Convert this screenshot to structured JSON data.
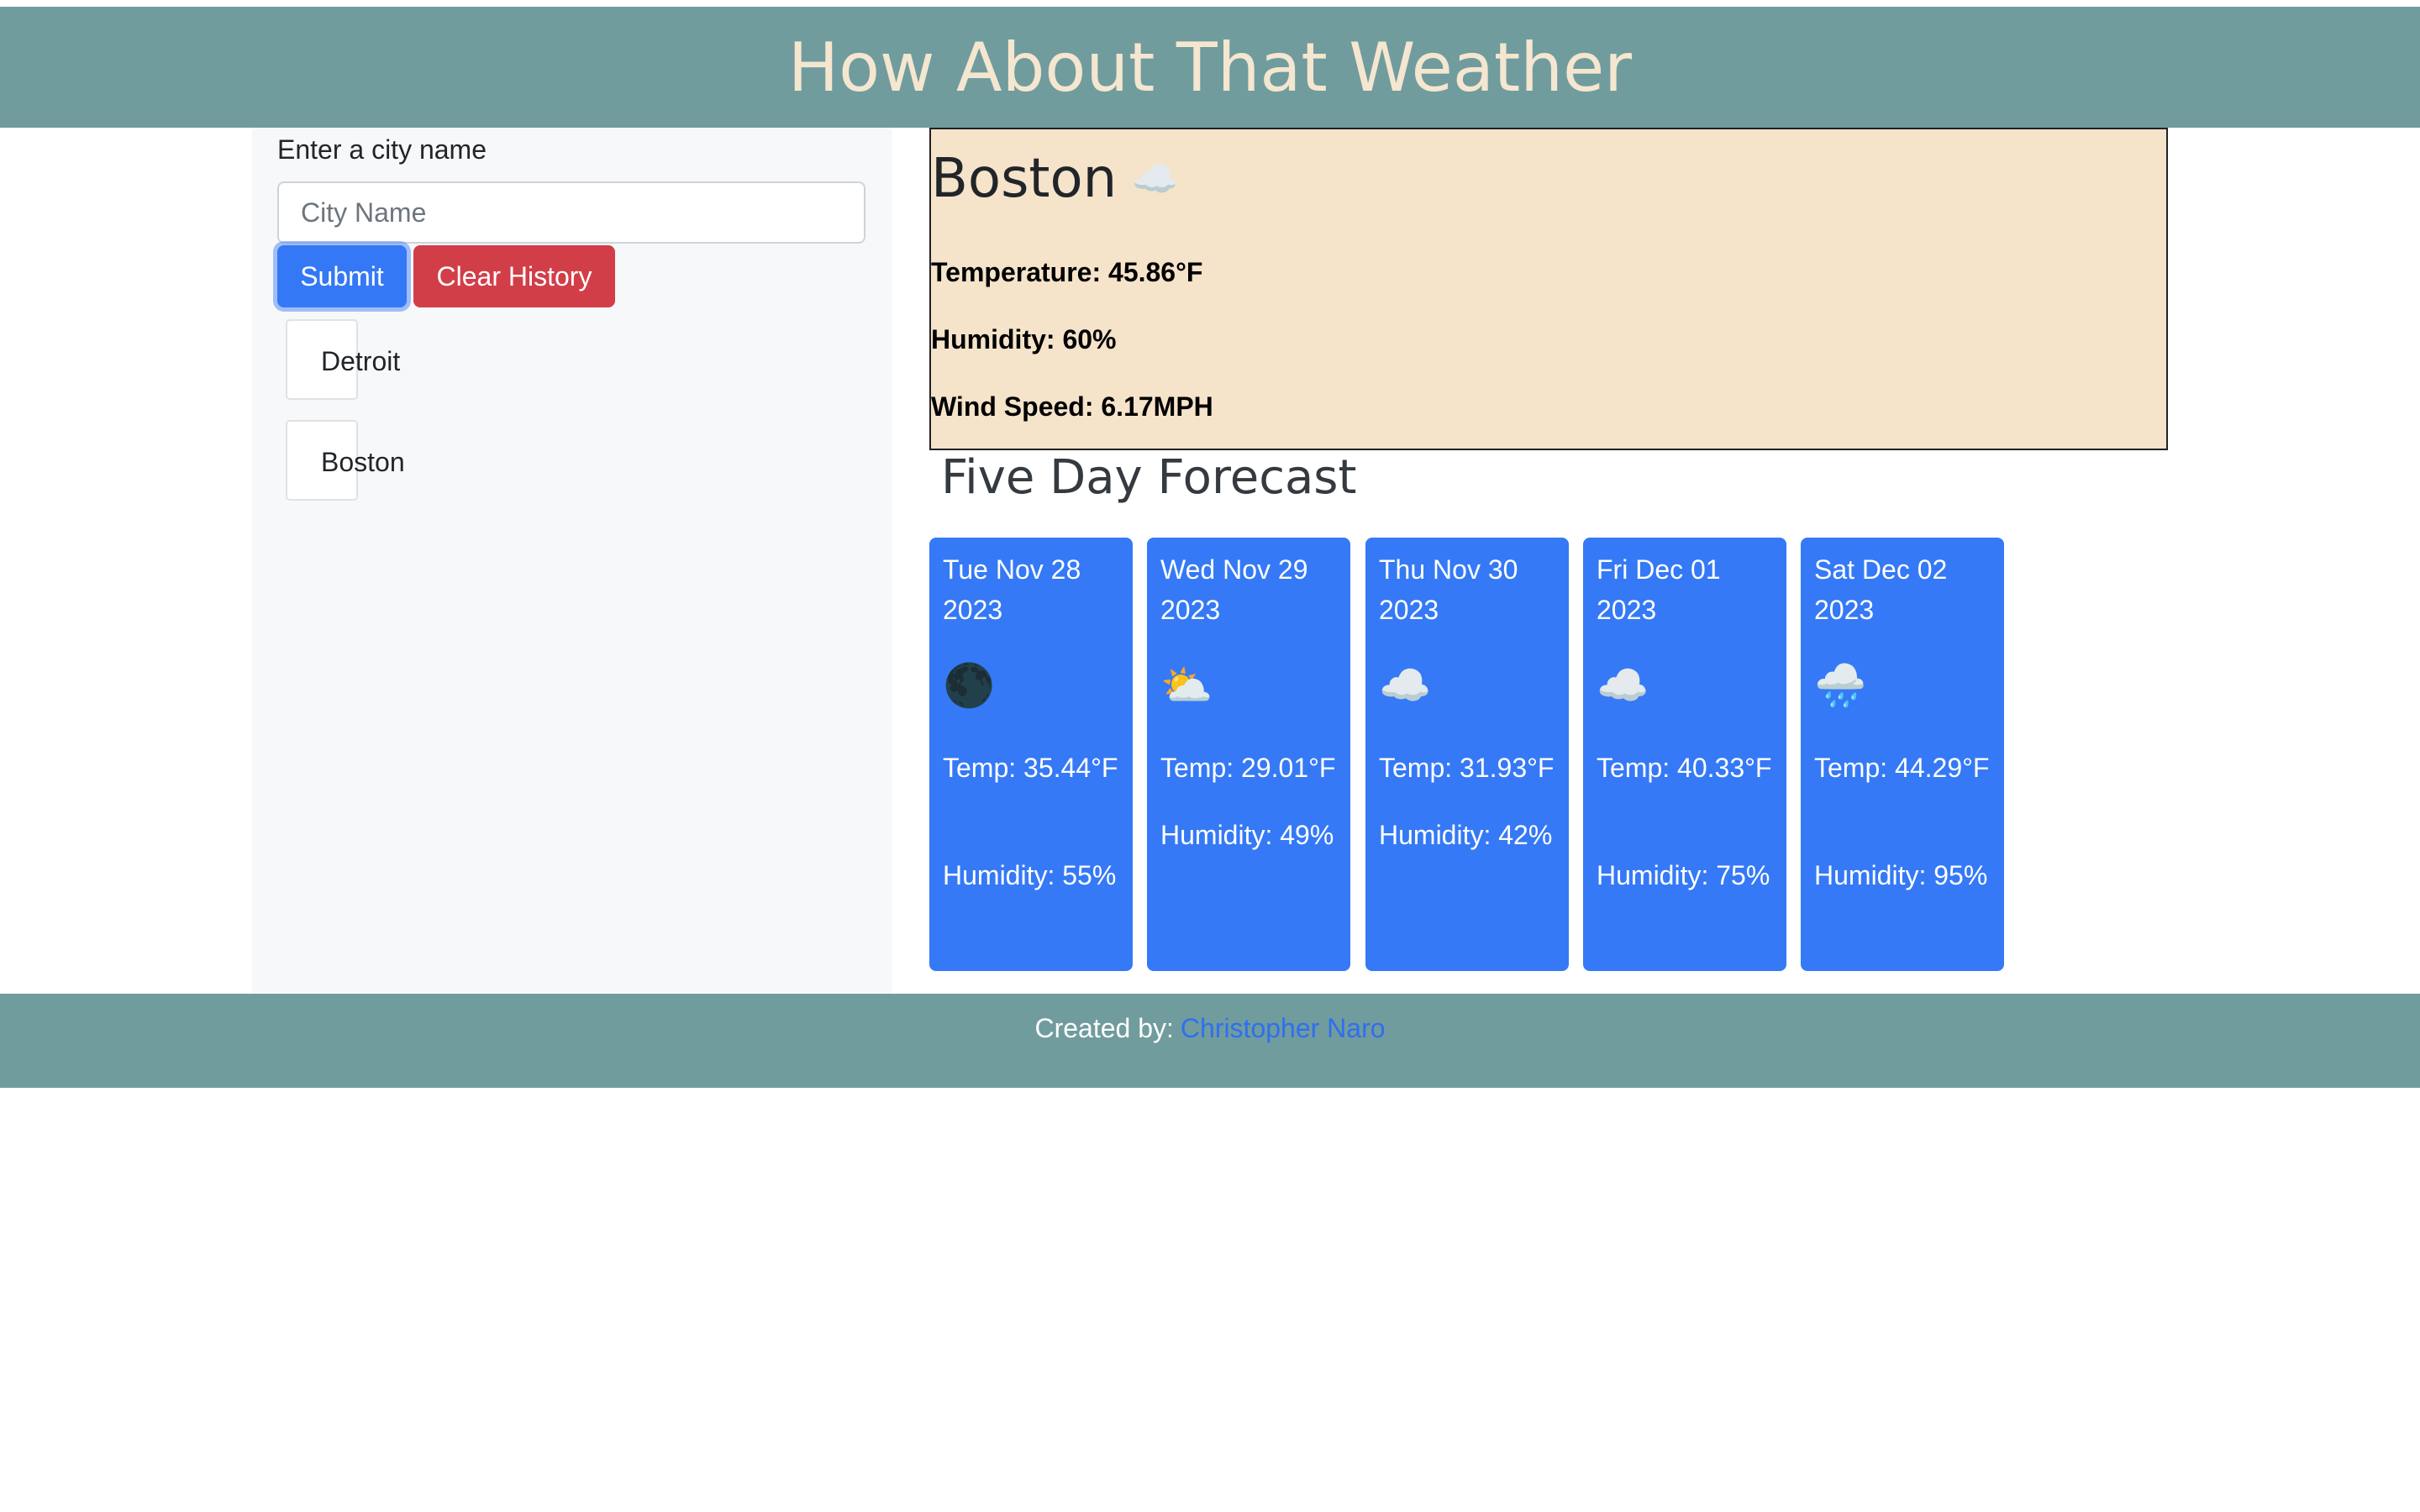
{
  "header": {
    "title": "How About That Weather"
  },
  "search": {
    "label": "Enter a city name",
    "placeholder": "City Name",
    "value": "",
    "submit_label": "Submit",
    "clear_label": "Clear History"
  },
  "history": [
    {
      "label": "Detroit"
    },
    {
      "label": "Boston"
    }
  ],
  "current": {
    "city": "Boston",
    "icon": "cloud-icon",
    "temperature": "Temperature: 45.86°F",
    "humidity": "Humidity: 60%",
    "wind": "Wind Speed: 6.17MPH"
  },
  "forecast": {
    "title": "Five Day Forecast",
    "days": [
      {
        "date": "Tue Nov 28 2023",
        "icon": "clear-night-icon",
        "temp": "Temp: 35.44°F",
        "humidity": "Humidity: 55%"
      },
      {
        "date": "Wed Nov 29 2023",
        "icon": "partly-cloudy-icon",
        "temp": "Temp: 29.01°F",
        "humidity": "Humidity: 49%"
      },
      {
        "date": "Thu Nov 30 2023",
        "icon": "broken-clouds-icon",
        "temp": "Temp: 31.93°F",
        "humidity": "Humidity: 42%"
      },
      {
        "date": "Fri Dec 01 2023",
        "icon": "broken-clouds-icon",
        "temp": "Temp: 40.33°F",
        "humidity": "Humidity: 75%"
      },
      {
        "date": "Sat Dec 02 2023",
        "icon": "rain-icon",
        "temp": "Temp: 44.29°F",
        "humidity": "Humidity: 95%"
      }
    ]
  },
  "footer": {
    "prefix": "Created by:",
    "author": "Christopher Naro"
  },
  "colors": {
    "header_bg": "#709c9e",
    "header_text": "#f5e6d0",
    "current_bg": "#f5e3ca",
    "card_bg": "#3579f6",
    "submit_bg": "#3478f6",
    "clear_bg": "#d23e48",
    "link": "#2f6fef"
  }
}
